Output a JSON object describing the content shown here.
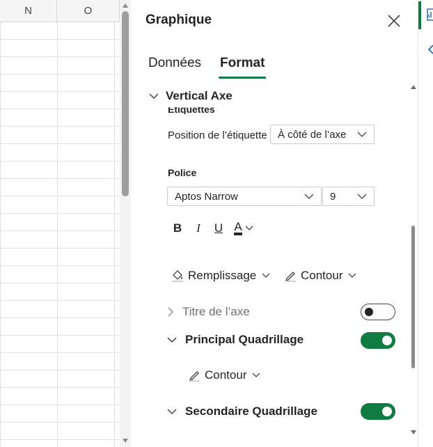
{
  "sheet": {
    "columns": [
      "N",
      "O"
    ]
  },
  "pane": {
    "title": "Graphique",
    "tabs": [
      {
        "label": "Données",
        "active": false
      },
      {
        "label": "Format",
        "active": true
      }
    ],
    "section": {
      "title": "Vertical Axe",
      "subsection_cut": "Étiquettes"
    },
    "label_position": {
      "label": "Position de l’étiquette",
      "value": "À côté de l’axe"
    },
    "font": {
      "label": "Police",
      "family": "Aptos Narrow",
      "size": "9",
      "bold": "B",
      "italic": "I",
      "underline": "U",
      "color_glyph": "A"
    },
    "fill": {
      "label": "Remplissage"
    },
    "outline": {
      "label": "Contour"
    },
    "axis_title": {
      "label": "Titre de l’axe",
      "enabled": false
    },
    "major_grid": {
      "label": "Principal Quadrillage",
      "enabled": true,
      "outline_label": "Contour"
    },
    "minor_grid": {
      "label": "Secondaire Quadrillage",
      "enabled": true
    }
  },
  "colors": {
    "accent": "#107c41",
    "text": "#242424"
  }
}
